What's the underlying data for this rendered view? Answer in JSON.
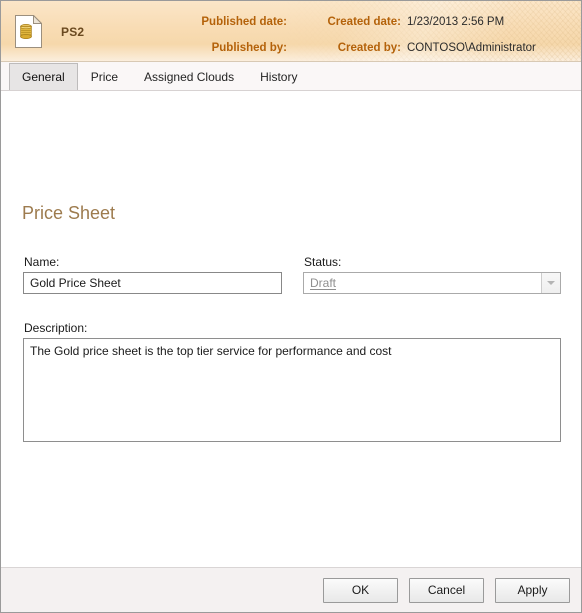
{
  "window": {
    "title": "PS2",
    "icon": "price-sheet-document-icon"
  },
  "header": {
    "title": "PS2",
    "meta": [
      {
        "label": "Published date:",
        "value": ""
      },
      {
        "label": "Created date:",
        "value": "1/23/2013 2:56 PM"
      },
      {
        "label": "Published by:",
        "value": ""
      },
      {
        "label": "Created by:",
        "value": "CONTOSO\\Administrator"
      }
    ],
    "accent_color": "#b4620a",
    "background_color": "#f8dcb4"
  },
  "tabs": [
    {
      "label": "General",
      "active": true
    },
    {
      "label": "Price",
      "active": false
    },
    {
      "label": "Assigned Clouds",
      "active": false
    },
    {
      "label": "History",
      "active": false
    }
  ],
  "main": {
    "heading": "Price Sheet",
    "heading_color": "#9d7b4e",
    "fields": {
      "name": {
        "label": "Name:",
        "value": "Gold Price Sheet",
        "placeholder": ""
      },
      "status": {
        "label": "Status:",
        "value": "Draft",
        "placeholder": "",
        "disabled": true,
        "arrow_icon": "chevron-down-icon"
      },
      "description": {
        "label": "Description:",
        "value": "The Gold price sheet is the top tier service for performance and cost",
        "placeholder": ""
      }
    }
  },
  "footer": {
    "buttons": [
      {
        "label": "OK",
        "name": "ok-button"
      },
      {
        "label": "Cancel",
        "name": "cancel-button"
      },
      {
        "label": "Apply",
        "name": "apply-button"
      }
    ]
  }
}
